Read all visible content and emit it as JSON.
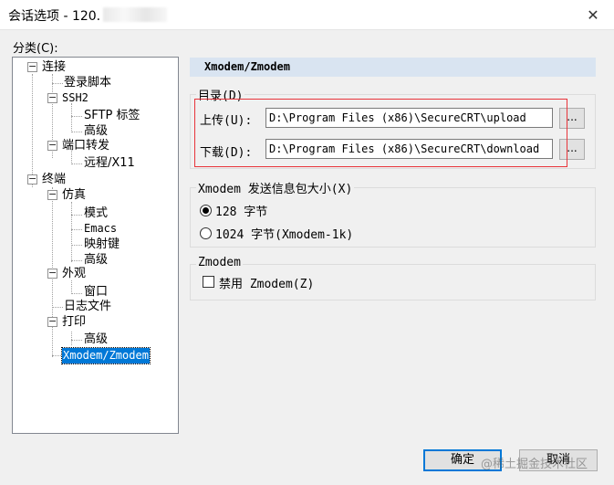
{
  "window": {
    "title": "会话选项 - 120.",
    "close": "✕"
  },
  "category_label": "分类(C):",
  "tree": {
    "items": [
      {
        "label": "连接"
      },
      {
        "label": "登录脚本"
      },
      {
        "label": "SSH2"
      },
      {
        "label": "SFTP 标签"
      },
      {
        "label": "高级"
      },
      {
        "label": "端口转发"
      },
      {
        "label": "远程/X11"
      },
      {
        "label": "终端"
      },
      {
        "label": "仿真"
      },
      {
        "label": "模式"
      },
      {
        "label": "Emacs"
      },
      {
        "label": "映射键"
      },
      {
        "label": "高级"
      },
      {
        "label": "外观"
      },
      {
        "label": "窗口"
      },
      {
        "label": "日志文件"
      },
      {
        "label": "打印"
      },
      {
        "label": "高级"
      },
      {
        "label": "Xmodem/Zmodem",
        "selected": true
      }
    ],
    "expander": "−"
  },
  "panel": {
    "title": "Xmodem/Zmodem",
    "directory": {
      "label": "目录(D)",
      "upload_label": "上传(U):",
      "upload_value": "D:\\Program Files (x86)\\SecureCRT\\upload",
      "download_label": "下载(D):",
      "download_value": "D:\\Program Files (x86)\\SecureCRT\\download",
      "browse": "..."
    },
    "packet": {
      "label": "Xmodem 发送信息包大小(X)",
      "option_128": "128 字节",
      "option_1024": "1024 字节(Xmodem-1k)",
      "selected": "128 字节"
    },
    "zmodem": {
      "label": "Zmodem",
      "disable_label": "禁用 Zmodem(Z)",
      "disabled": false
    }
  },
  "buttons": {
    "ok": "确定",
    "cancel": "取消"
  },
  "watermark": "@稀土掘金技术社区",
  "colors": {
    "accent": "#0078d7",
    "header_bg": "#d9e4f1",
    "highlight": "#e8343a"
  }
}
